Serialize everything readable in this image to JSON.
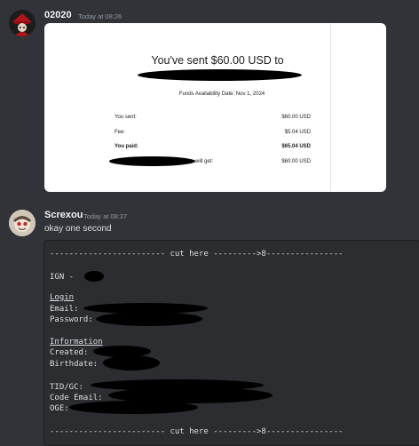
{
  "messages": [
    {
      "username": "02020",
      "timestamp": "Today at 08:26",
      "receipt": {
        "headline": "You've sent $60.00 USD to",
        "availability": "Funds Availability Date: Nov 1, 2024",
        "rows": [
          {
            "label": "You sent:",
            "value": "$60.00 USD",
            "bold": false
          },
          {
            "label": "Fee:",
            "value": "$5.04 USD",
            "bold": false
          },
          {
            "label": "You paid:",
            "value": "$65.04 USD",
            "bold": true
          },
          {
            "label": "will get:",
            "value": "$60.00 USD",
            "bold": false
          }
        ]
      }
    },
    {
      "username": "Screxou",
      "timestamp": "Today at 08:27",
      "text": "okay one second",
      "code_lines": [
        "------------------------ cut here --------->8----------------",
        "IGN -",
        "Login",
        "Email:",
        "Password:",
        "Information",
        "Created:",
        "Birthdate:",
        "TID/GC:",
        "Code Email:",
        "OGE:",
        "------------------------ cut here --------->8----------------"
      ]
    }
  ],
  "colors": {
    "background": "#313338",
    "code_background": "#2b2d31",
    "receipt_background": "#ffffff",
    "redaction": "#000000"
  }
}
